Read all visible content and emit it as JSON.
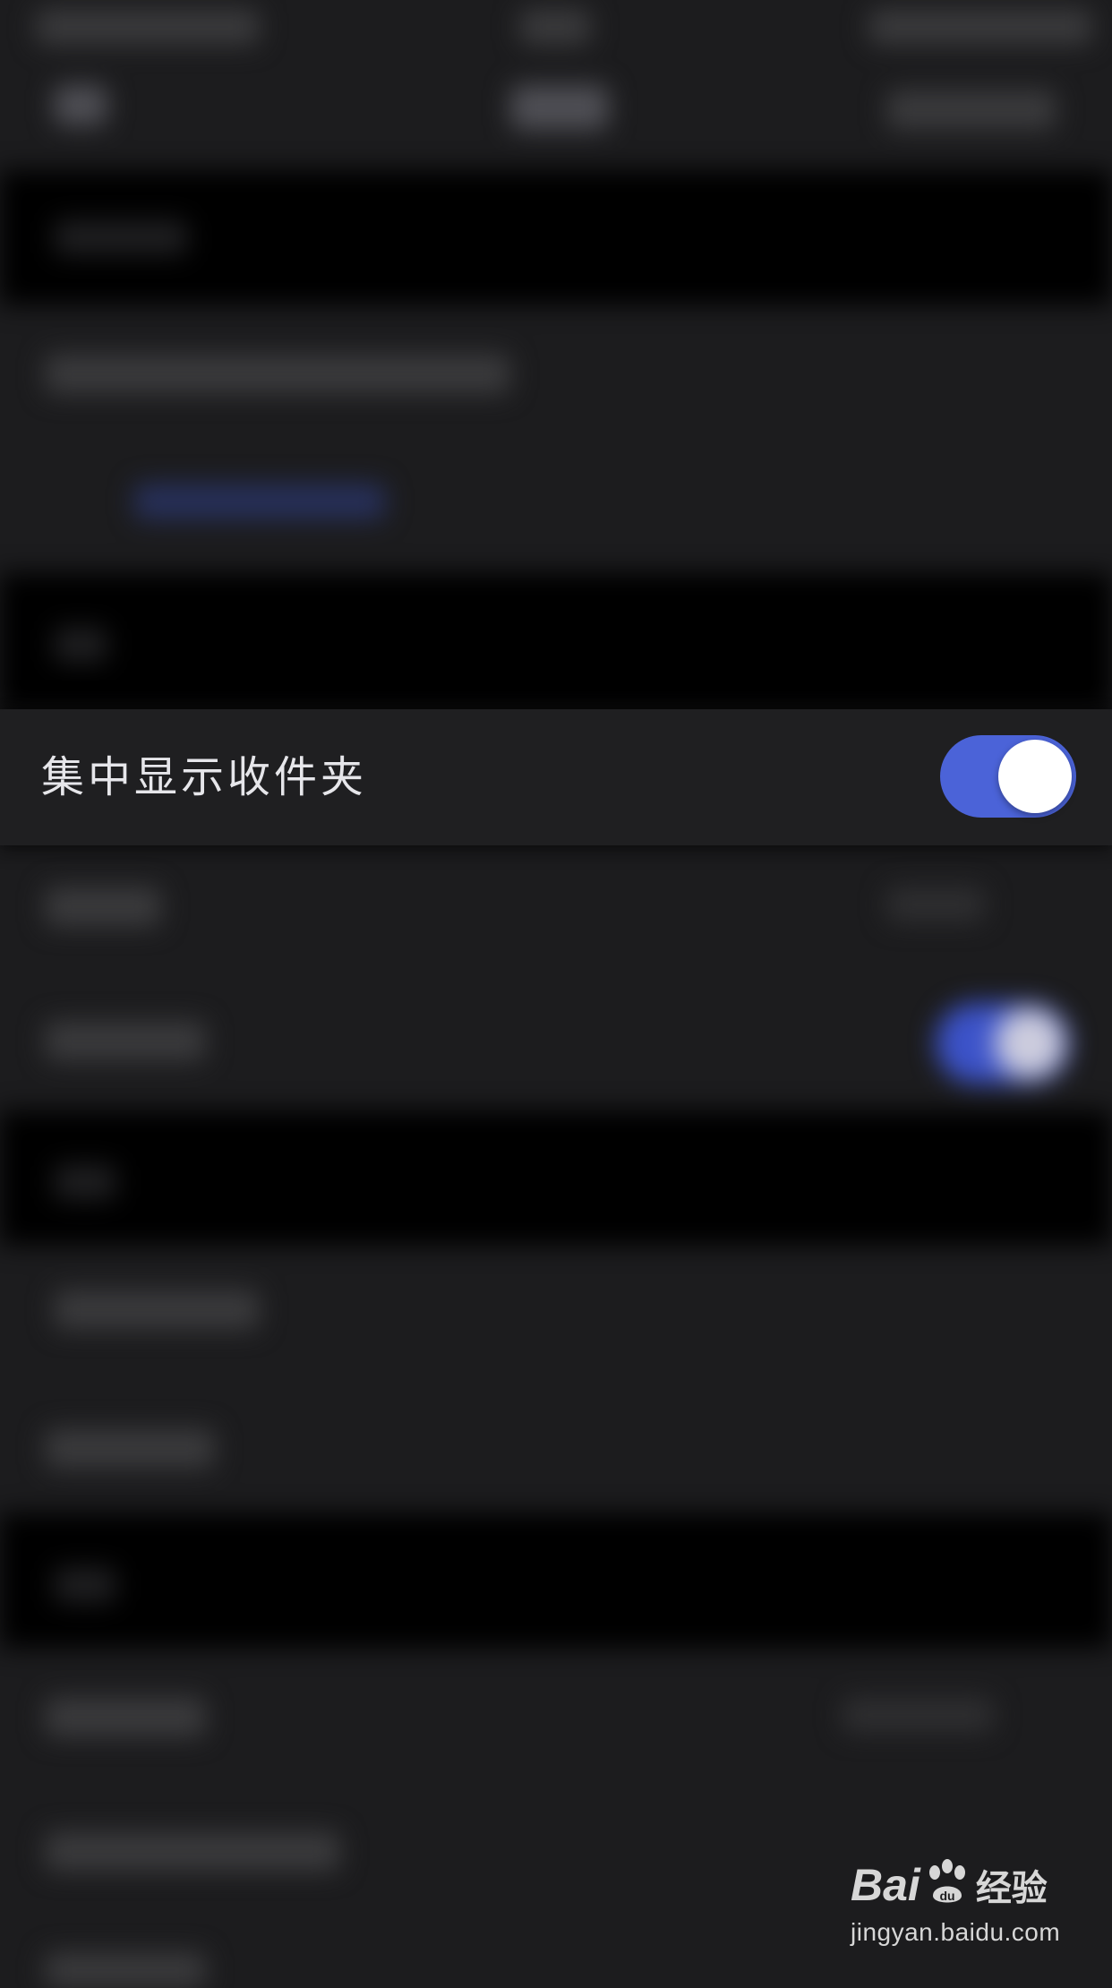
{
  "focused_setting": {
    "label": "集中显示收件夹",
    "enabled": true
  },
  "colors": {
    "background": "#1c1c1e",
    "toggle_on": "#4b63d8",
    "knob": "#ffffff",
    "label_text": "#e6e6ea"
  },
  "watermark": {
    "brand_left": "Bai",
    "brand_right": "经验",
    "domain": "jingyan.baidu.com",
    "icon": "paw-icon"
  }
}
